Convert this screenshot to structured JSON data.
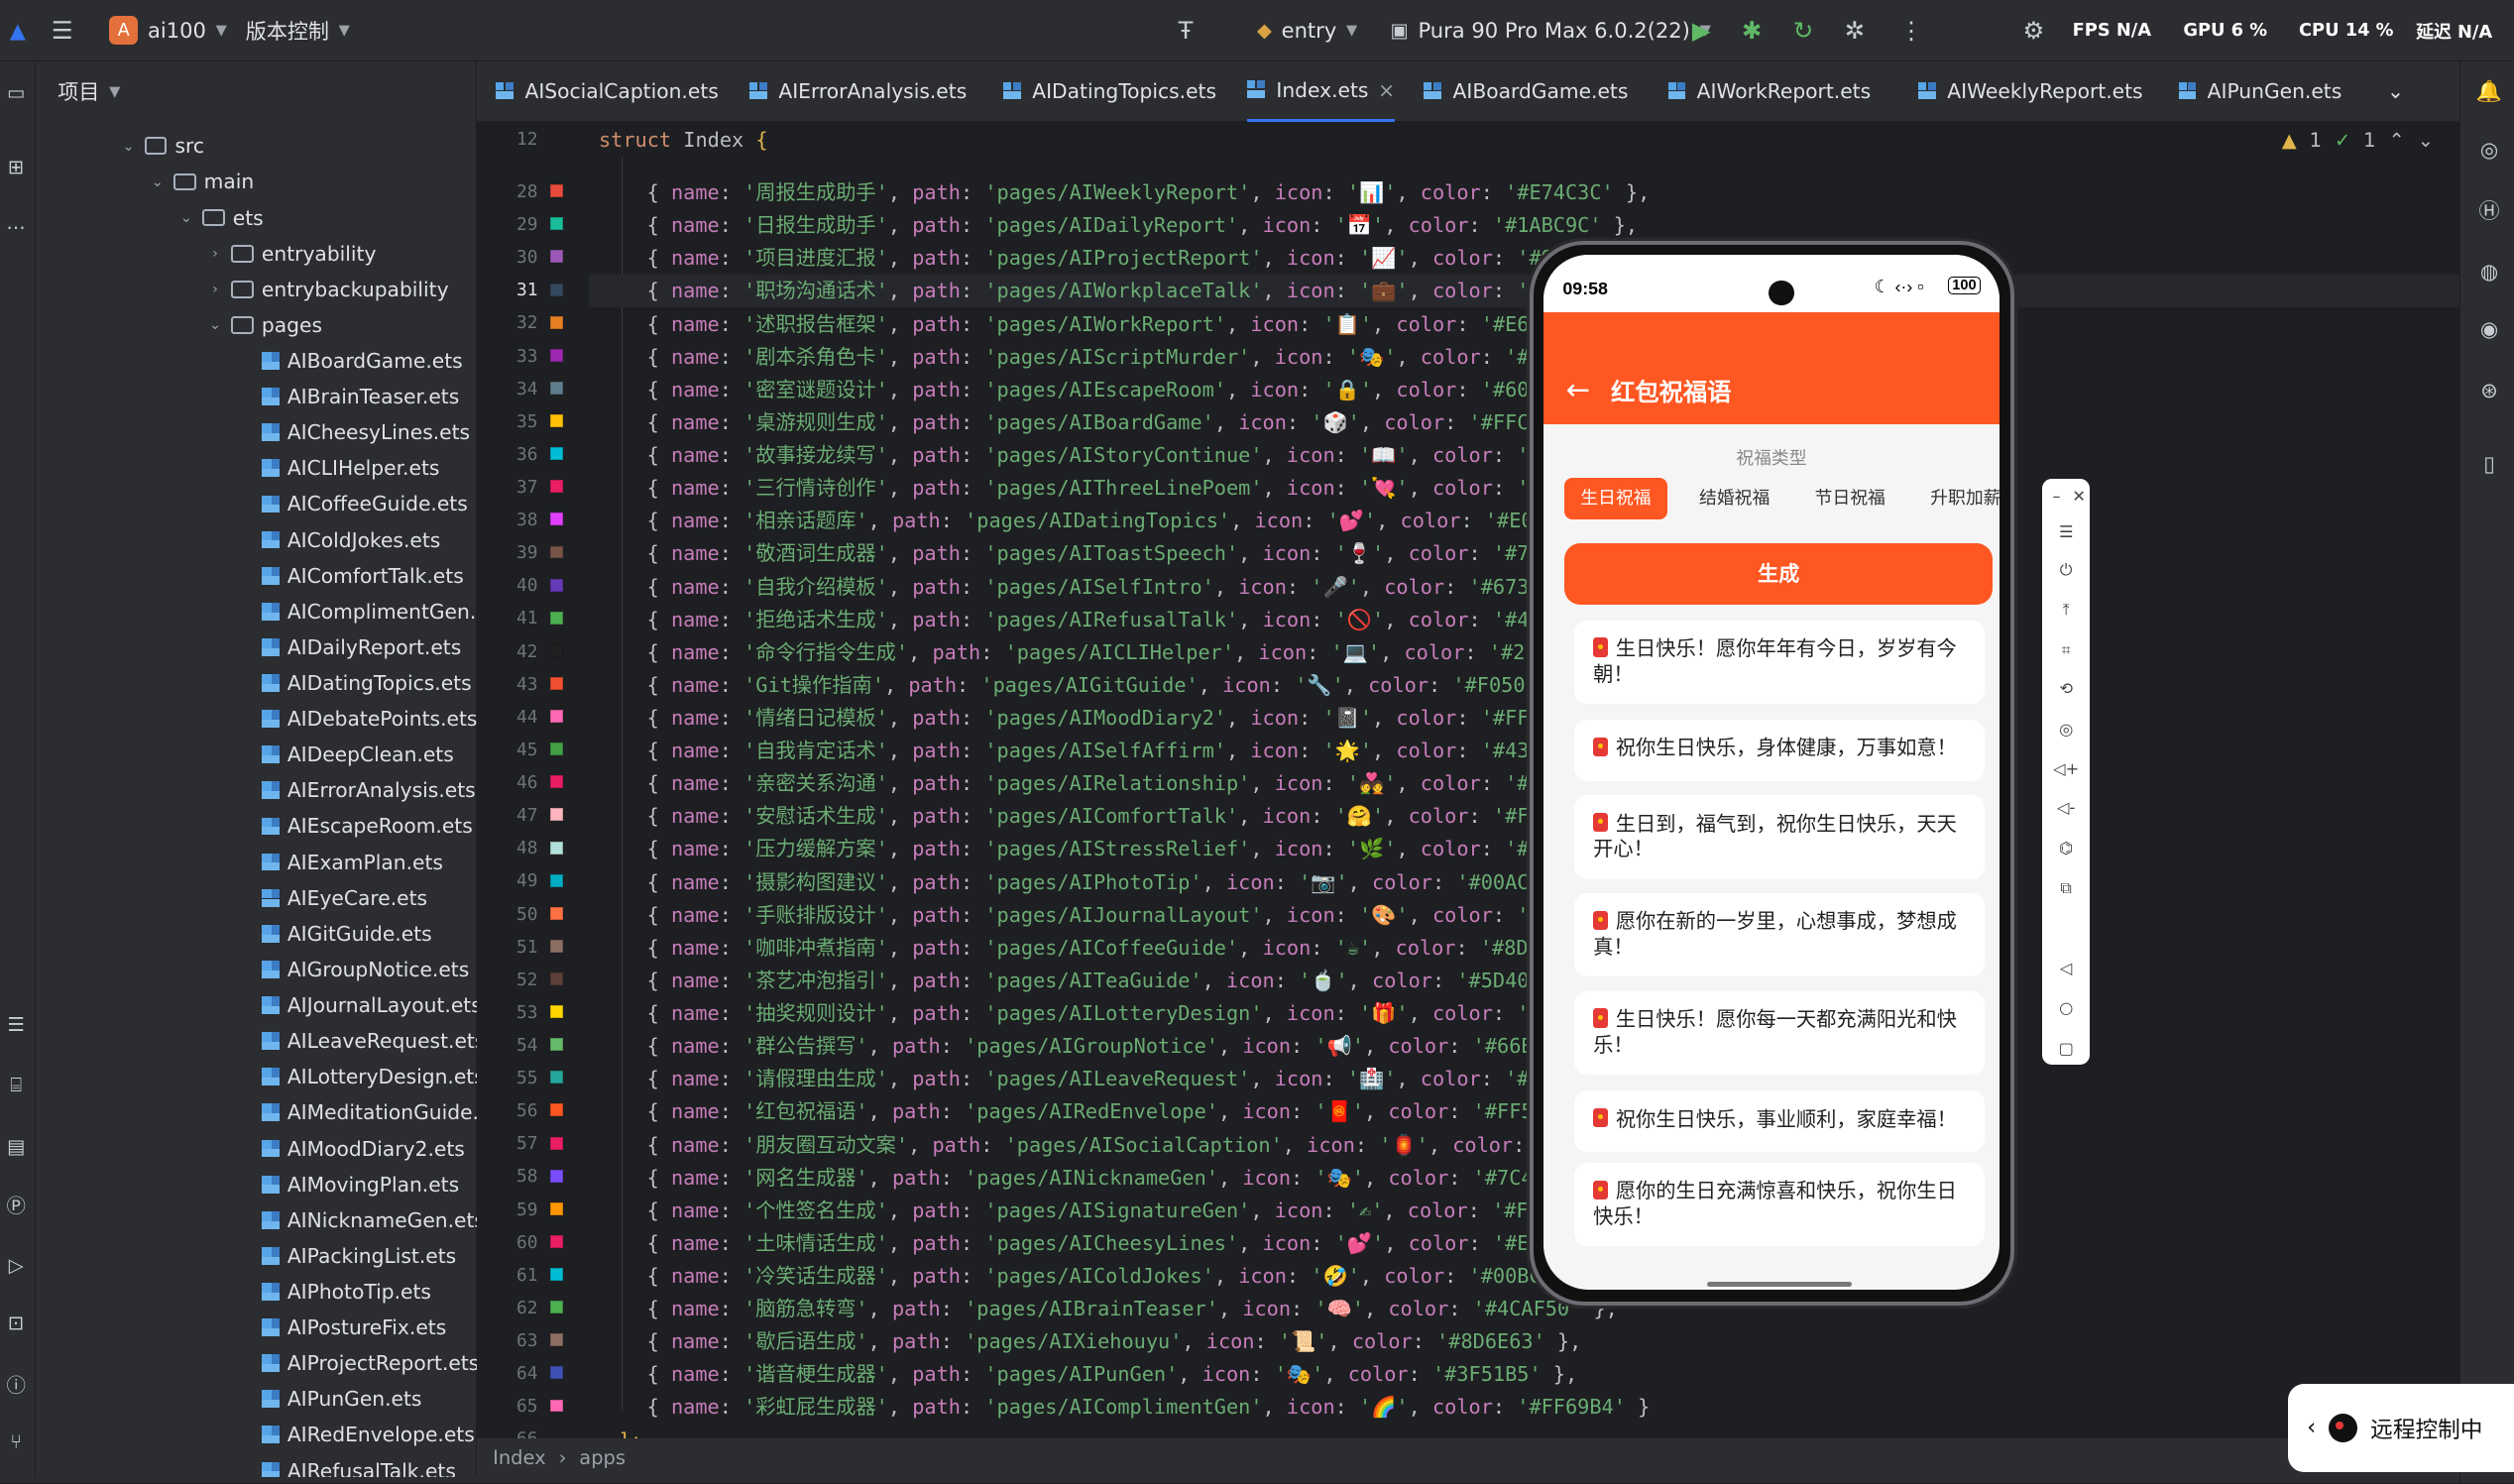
{
  "titlebar": {
    "project_badge": "A",
    "project_name": "ai100",
    "vcs": "版本控制",
    "run_config": "entry",
    "device": "Pura 90 Pro Max 6.0.2(22)",
    "fps": "FPS N/A",
    "gpu": "GPU 6 %",
    "cpu": "CPU 14 %",
    "latency": "延迟 N/A"
  },
  "project": {
    "title": "项目",
    "nodes": [
      {
        "label": "src",
        "type": "folder",
        "depth": 0,
        "open": true
      },
      {
        "label": "main",
        "type": "folder",
        "depth": 1,
        "open": true
      },
      {
        "label": "ets",
        "type": "folder",
        "depth": 2,
        "open": true
      },
      {
        "label": "entryability",
        "type": "folder",
        "depth": 3,
        "open": false
      },
      {
        "label": "entrybackupability",
        "type": "folder",
        "depth": 3,
        "open": false
      },
      {
        "label": "pages",
        "type": "folder",
        "depth": 3,
        "open": true
      },
      {
        "label": "AIBoardGame.ets",
        "type": "file"
      },
      {
        "label": "AIBrainTeaser.ets",
        "type": "file"
      },
      {
        "label": "AICheesyLines.ets",
        "type": "file"
      },
      {
        "label": "AICLIHelper.ets",
        "type": "file"
      },
      {
        "label": "AICoffeeGuide.ets",
        "type": "file"
      },
      {
        "label": "AIColdJokes.ets",
        "type": "file"
      },
      {
        "label": "AIComfortTalk.ets",
        "type": "file"
      },
      {
        "label": "AIComplimentGen.ets",
        "type": "file"
      },
      {
        "label": "AIDailyReport.ets",
        "type": "file"
      },
      {
        "label": "AIDatingTopics.ets",
        "type": "file"
      },
      {
        "label": "AIDebatePoints.ets",
        "type": "file"
      },
      {
        "label": "AIDeepClean.ets",
        "type": "file"
      },
      {
        "label": "AIErrorAnalysis.ets",
        "type": "file"
      },
      {
        "label": "AIEscapeRoom.ets",
        "type": "file"
      },
      {
        "label": "AIExamPlan.ets",
        "type": "file"
      },
      {
        "label": "AIEyeCare.ets",
        "type": "file"
      },
      {
        "label": "AIGitGuide.ets",
        "type": "file"
      },
      {
        "label": "AIGroupNotice.ets",
        "type": "file"
      },
      {
        "label": "AIJournalLayout.ets",
        "type": "file"
      },
      {
        "label": "AILeaveRequest.ets",
        "type": "file"
      },
      {
        "label": "AILotteryDesign.ets",
        "type": "file"
      },
      {
        "label": "AIMeditationGuide.ets",
        "type": "file"
      },
      {
        "label": "AIMoodDiary2.ets",
        "type": "file"
      },
      {
        "label": "AIMovingPlan.ets",
        "type": "file"
      },
      {
        "label": "AINicknameGen.ets",
        "type": "file"
      },
      {
        "label": "AIPackingList.ets",
        "type": "file"
      },
      {
        "label": "AIPhotoTip.ets",
        "type": "file"
      },
      {
        "label": "AIPostureFix.ets",
        "type": "file"
      },
      {
        "label": "AIProjectReport.ets",
        "type": "file"
      },
      {
        "label": "AIPunGen.ets",
        "type": "file"
      },
      {
        "label": "AIRedEnvelope.ets",
        "type": "file"
      },
      {
        "label": "AIRefusalTalk.ets",
        "type": "file"
      }
    ]
  },
  "tabs": [
    {
      "label": "AISocialCaption.ets",
      "active": false
    },
    {
      "label": "AIErrorAnalysis.ets",
      "active": false
    },
    {
      "label": "AIDatingTopics.ets",
      "active": false
    },
    {
      "label": "Index.ets",
      "active": true
    },
    {
      "label": "AIBoardGame.ets",
      "active": false
    },
    {
      "label": "AIWorkReport.ets",
      "active": false
    },
    {
      "label": "AIWeeklyReport.ets",
      "active": false
    },
    {
      "label": "AIPunGen.ets",
      "active": false
    }
  ],
  "inspection": {
    "warnings": "1",
    "checks": "1"
  },
  "editor": {
    "header_line": "12",
    "header_kw": "struct",
    "header_name": "Index",
    "header_brace": "{",
    "lines": [
      {
        "n": "28",
        "name": "'周报生成助手'",
        "path": "'pages/AIWeeklyReport'",
        "icon": "'📊'",
        "color": "'#E74C3C'",
        "tail": " },",
        "swatch": "#E74C3C"
      },
      {
        "n": "29",
        "name": "'日报生成助手'",
        "path": "'pages/AIDailyReport'",
        "icon": "'📅'",
        "color": "'#1ABC9C'",
        "tail": " },",
        "swatch": "#1ABC9C"
      },
      {
        "n": "30",
        "name": "'项目进度汇报'",
        "path": "'pages/AIProjectReport'",
        "icon": "'📈'",
        "color": "'#9B59B6'",
        "tail": " },",
        "swatch": "#9B59B6"
      },
      {
        "n": "31",
        "name": "'职场沟通话术'",
        "path": "'pages/AIWorkplaceTalk'",
        "icon": "'💼'",
        "color": "'#34495E'",
        "tail": " },",
        "swatch": "#34495E",
        "hl": true
      },
      {
        "n": "32",
        "name": "'述职报告框架'",
        "path": "'pages/AIWorkReport'",
        "icon": "'📋'",
        "color": "'#E67E22'",
        "tail": " },",
        "swatch": "#E67E22"
      },
      {
        "n": "33",
        "name": "'剧本杀角色卡'",
        "path": "'pages/AIScriptMurder'",
        "icon": "'🎭'",
        "color": "'#9C27B0'",
        "tail": " },",
        "swatch": "#9C27B0"
      },
      {
        "n": "34",
        "name": "'密室谜题设计'",
        "path": "'pages/AIEscapeRoom'",
        "icon": "'🔒'",
        "color": "'#607D8B'",
        "tail": " },",
        "swatch": "#607D8B"
      },
      {
        "n": "35",
        "name": "'桌游规则生成'",
        "path": "'pages/AIBoardGame'",
        "icon": "'🎲'",
        "color": "'#FFC107'",
        "tail": " },",
        "swatch": "#FFC107"
      },
      {
        "n": "36",
        "name": "'故事接龙续写'",
        "path": "'pages/AIStoryContinue'",
        "icon": "'📖'",
        "color": "'#00BCD4'",
        "tail": " },",
        "swatch": "#00BCD4"
      },
      {
        "n": "37",
        "name": "'三行情诗创作'",
        "path": "'pages/AIThreeLinePoem'",
        "icon": "'💘'",
        "color": "'#E91E63'",
        "tail": " },",
        "swatch": "#E91E63"
      },
      {
        "n": "38",
        "name": "'相亲话题库'",
        "path": "'pages/AIDatingTopics'",
        "icon": "'💕'",
        "color": "'#E040FB'",
        "tail": " },",
        "swatch": "#E040FB"
      },
      {
        "n": "39",
        "name": "'敬酒词生成器'",
        "path": "'pages/AIToastSpeech'",
        "icon": "'🍷'",
        "color": "'#795548'",
        "tail": " },",
        "swatch": "#795548"
      },
      {
        "n": "40",
        "name": "'自我介绍模板'",
        "path": "'pages/AISelfIntro'",
        "icon": "'🎤'",
        "color": "'#673AB7'",
        "tail": " },",
        "swatch": "#673AB7"
      },
      {
        "n": "41",
        "name": "'拒绝话术生成'",
        "path": "'pages/AIRefusalTalk'",
        "icon": "'🚫'",
        "color": "'#4CAF50'",
        "tail": " },",
        "swatch": "#4CAF50"
      },
      {
        "n": "42",
        "name": "'命令行指令生成'",
        "path": "'pages/AICLIHelper'",
        "icon": "'💻'",
        "color": "'#212121'",
        "tail": " },",
        "swatch": "#212121"
      },
      {
        "n": "43",
        "name": "'Git操作指南'",
        "path": "'pages/AIGitGuide'",
        "icon": "'🔧'",
        "color": "'#F05032'",
        "tail": " },",
        "swatch": "#F05032"
      },
      {
        "n": "44",
        "name": "'情绪日记模板'",
        "path": "'pages/AIMoodDiary2'",
        "icon": "'📓'",
        "color": "'#FF69B4'",
        "tail": " },",
        "swatch": "#FF69B4"
      },
      {
        "n": "45",
        "name": "'自我肯定话术'",
        "path": "'pages/AISelfAffirm'",
        "icon": "'🌟'",
        "color": "'#43A047'",
        "tail": " },",
        "swatch": "#43A047"
      },
      {
        "n": "46",
        "name": "'亲密关系沟通'",
        "path": "'pages/AIRelationship'",
        "icon": "'💑'",
        "color": "'#E91E63'",
        "tail": " },",
        "swatch": "#E91E63"
      },
      {
        "n": "47",
        "name": "'安慰话术生成'",
        "path": "'pages/AIComfortTalk'",
        "icon": "'🤗'",
        "color": "'#FFB6C1'",
        "tail": " },",
        "swatch": "#FFB6C1"
      },
      {
        "n": "48",
        "name": "'压力缓解方案'",
        "path": "'pages/AIStressRelief'",
        "icon": "'🌿'",
        "color": "'#B2DFDB'",
        "tail": " },",
        "swatch": "#B2DFDB"
      },
      {
        "n": "49",
        "name": "'摄影构图建议'",
        "path": "'pages/AIPhotoTip'",
        "icon": "'📷'",
        "color": "'#00ACC1'",
        "tail": " },",
        "swatch": "#00ACC1"
      },
      {
        "n": "50",
        "name": "'手账排版设计'",
        "path": "'pages/AIJournalLayout'",
        "icon": "'🎨'",
        "color": "'#9C27B0'",
        "tail": " },",
        "swatch": "#FF7043"
      },
      {
        "n": "51",
        "name": "'咖啡冲煮指南'",
        "path": "'pages/AICoffeeGuide'",
        "icon": "'☕'",
        "color": "'#8D6E63'",
        "tail": " },",
        "swatch": "#8D6E63"
      },
      {
        "n": "52",
        "name": "'茶艺冲泡指引'",
        "path": "'pages/AITeaGuide'",
        "icon": "'🍵'",
        "color": "'#5D4037'",
        "tail": " },",
        "swatch": "#5D4037"
      },
      {
        "n": "53",
        "name": "'抽奖规则设计'",
        "path": "'pages/AILotteryDesign'",
        "icon": "'🎁'",
        "color": "'#FFC107'",
        "tail": " },",
        "swatch": "#FFD600"
      },
      {
        "n": "54",
        "name": "'群公告撰写'",
        "path": "'pages/AIGroupNotice'",
        "icon": "'📢'",
        "color": "'#66BB6A'",
        "tail": " },",
        "swatch": "#66BB6A"
      },
      {
        "n": "55",
        "name": "'请假理由生成'",
        "path": "'pages/AILeaveRequest'",
        "icon": "'🏥'",
        "color": "'#009688'",
        "tail": " },",
        "swatch": "#26A69A"
      },
      {
        "n": "56",
        "name": "'红包祝福语'",
        "path": "'pages/AIRedEnvelope'",
        "icon": "'🧧'",
        "color": "'#FF5722'",
        "tail": " },",
        "swatch": "#FF5722"
      },
      {
        "n": "57",
        "name": "'朋友圈互动文案'",
        "path": "'pages/AISocialCaption'",
        "icon": "'🏮'",
        "color": "'#E91E63'",
        "tail": " },",
        "swatch": "#E91E63"
      },
      {
        "n": "58",
        "name": "'网名生成器'",
        "path": "'pages/AINicknameGen'",
        "icon": "'🎭'",
        "color": "'#7C4DFF'",
        "tail": " },",
        "swatch": "#7C4DFF"
      },
      {
        "n": "59",
        "name": "'个性签名生成'",
        "path": "'pages/AISignatureGen'",
        "icon": "'✍'",
        "color": "'#FF9800'",
        "tail": " },",
        "swatch": "#FF9800"
      },
      {
        "n": "60",
        "name": "'土味情话生成'",
        "path": "'pages/AICheesyLines'",
        "icon": "'💕'",
        "color": "'#E91E63'",
        "tail": " },",
        "swatch": "#E91E63"
      },
      {
        "n": "61",
        "name": "'冷笑话生成器'",
        "path": "'pages/AIColdJokes'",
        "icon": "'🤣'",
        "color": "'#00BCD4'",
        "tail": " },",
        "swatch": "#00BCD4"
      },
      {
        "n": "62",
        "name": "'脑筋急转弯'",
        "path": "'pages/AIBrainTeaser'",
        "icon": "'🧠'",
        "color": "'#4CAF50'",
        "tail": " },",
        "swatch": "#4CAF50"
      },
      {
        "n": "63",
        "name": "'歇后语生成'",
        "path": "'pages/AIXiehouyu'",
        "icon": "'📜'",
        "color": "'#8D6E63'",
        "tail": " },",
        "swatch": "#8D6E63"
      },
      {
        "n": "64",
        "name": "'谐音梗生成器'",
        "path": "'pages/AIPunGen'",
        "icon": "'🎭'",
        "color": "'#3F51B5'",
        "tail": " },",
        "swatch": "#3F51B5"
      },
      {
        "n": "65",
        "name": "'彩虹屁生成器'",
        "path": "'pages/AIComplimentGen'",
        "icon": "'🌈'",
        "color": "'#FF69B4'",
        "tail": " }",
        "swatch": "#FF69B4"
      }
    ],
    "closing_line": "66",
    "closing_text": "];"
  },
  "breadcrumb": [
    "Index",
    "apps"
  ],
  "phone": {
    "time": "09:58",
    "battery": "100",
    "title": "红包祝福语",
    "type_label": "祝福类型",
    "chips": [
      "生日祝福",
      "结婚祝福",
      "节日祝福",
      "升职加薪"
    ],
    "selected_chip": 0,
    "generate": "生成",
    "results": [
      "生日快乐！愿你年年有今日，岁岁有今朝！",
      "祝你生日快乐，身体健康，万事如意！",
      "生日到，福气到，祝你生日快乐，天天开心！",
      "愿你在新的一岁里，心想事成，梦想成真！",
      "生日快乐！愿你每一天都充满阳光和快乐！",
      "祝你生日快乐，事业顺利，家庭幸福！",
      "愿你的生日充满惊喜和快乐，祝你生日快乐！"
    ]
  },
  "remote": {
    "label": "远程控制中"
  },
  "colors": {
    "accent": "#3574f0",
    "phone_primary": "#ff5722"
  }
}
